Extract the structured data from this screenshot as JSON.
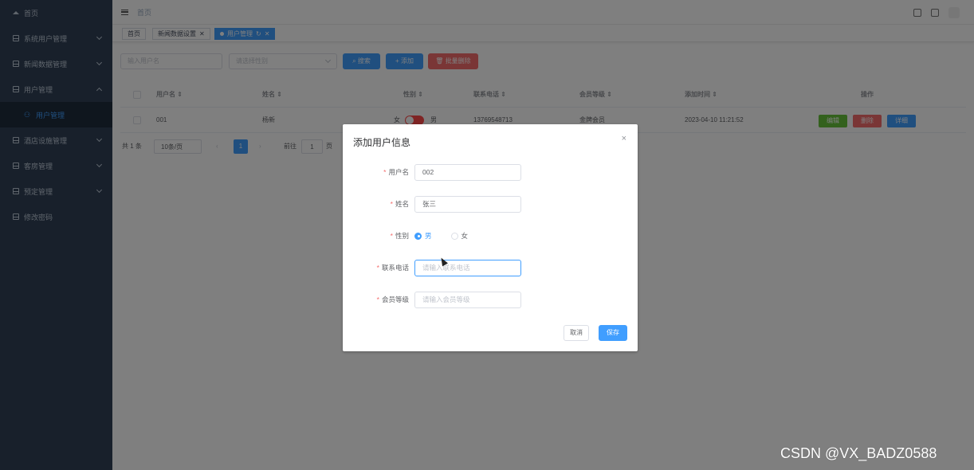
{
  "sidebar": {
    "items": [
      {
        "label": "首页",
        "icon": "home-icon"
      },
      {
        "label": "系统用户管理",
        "icon": "grid-icon"
      },
      {
        "label": "新闻数据管理",
        "icon": "grid-icon"
      },
      {
        "label": "用户管理",
        "icon": "grid-icon",
        "expanded": true
      },
      {
        "label": "酒店设施管理",
        "icon": "grid-icon"
      },
      {
        "label": "客房管理",
        "icon": "grid-icon"
      },
      {
        "label": "预定管理",
        "icon": "grid-icon"
      },
      {
        "label": "修改密码",
        "icon": "grid-icon"
      }
    ],
    "subitem": {
      "label": "用户管理",
      "icon": "user-icon"
    }
  },
  "navbar": {
    "breadcrumb": "首页"
  },
  "tags": [
    {
      "label": "首页"
    },
    {
      "label": "新闻数据设置",
      "close": "✕"
    },
    {
      "label": "用户管理",
      "refresh": "↻",
      "close": "✕",
      "active": true
    }
  ],
  "toolbar": {
    "search_placeholder": "输入用户名",
    "select_placeholder": "请选择性别",
    "search_label": "搜索",
    "add_label": "添加",
    "batch_delete_label": "批量删除"
  },
  "table": {
    "headers": [
      "用户名",
      "姓名",
      "性别",
      "联系电话",
      "会员等级",
      "添加时间",
      "操作"
    ],
    "sort_icon": "⇕",
    "rows": [
      {
        "username": "001",
        "name": "杨新",
        "gender_off": "女",
        "gender_on": "男",
        "phone": "13769548713",
        "level": "金牌会员",
        "created": "2023-04-10 11:21:52",
        "edit": "编辑",
        "delete": "删除",
        "detail": "详细"
      }
    ]
  },
  "pager": {
    "total": "共 1 条",
    "page_size": "10条/页",
    "prev": "‹",
    "current": "1",
    "next": "›",
    "goto": "前往",
    "goto_value": "1",
    "page_suffix": "页"
  },
  "dialog": {
    "title": "添加用户信息",
    "close": "×",
    "fields": {
      "username": {
        "label": "用户名",
        "value": "002"
      },
      "name": {
        "label": "姓名",
        "value": "张三"
      },
      "gender": {
        "label": "性别",
        "options": [
          "男",
          "女"
        ],
        "selected": "男"
      },
      "phone": {
        "label": "联系电话",
        "placeholder": "请输入联系电话"
      },
      "level": {
        "label": "会员等级",
        "placeholder": "请输入会员等级"
      }
    },
    "required_mark": "*",
    "cancel_label": "取消",
    "save_label": "保存"
  },
  "watermark": "CSDN @VX_BADZ0588",
  "colors": {
    "primary": "#409eff",
    "danger": "#f56c6c",
    "success": "#67c23a",
    "sidebar": "#304156"
  }
}
